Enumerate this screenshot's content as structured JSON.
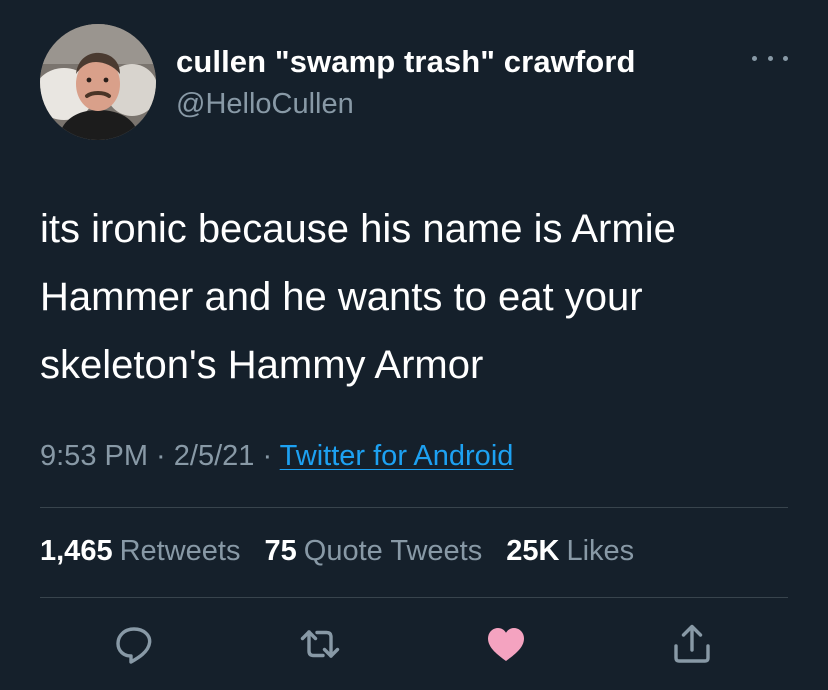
{
  "author": {
    "display_name": "cullen \"swamp trash\" crawford",
    "handle": "@HelloCullen",
    "avatar_icon": "profile-photo"
  },
  "tweet": {
    "text": "its ironic because his name is Armie Hammer and he wants to eat your skeleton's Hammy Armor",
    "time": "9:53 PM",
    "separator": " · ",
    "date": "2/5/21",
    "source": "Twitter for Android"
  },
  "stats": {
    "retweets_count": "1,465",
    "retweets_label": "Retweets",
    "quote_tweets_count": "75",
    "quote_tweets_label": "Quote Tweets",
    "likes_count": "25K",
    "likes_label": "Likes"
  },
  "actions": {
    "reply_icon": "reply-icon",
    "retweet_icon": "retweet-icon",
    "like_icon": "heart-icon",
    "share_icon": "share-icon"
  },
  "colors": {
    "background": "#15202b",
    "primary_text": "#ffffff",
    "secondary_text": "#8899a6",
    "link": "#1da1f2",
    "divider": "#38444d",
    "liked_heart": "#f4a3c0"
  }
}
